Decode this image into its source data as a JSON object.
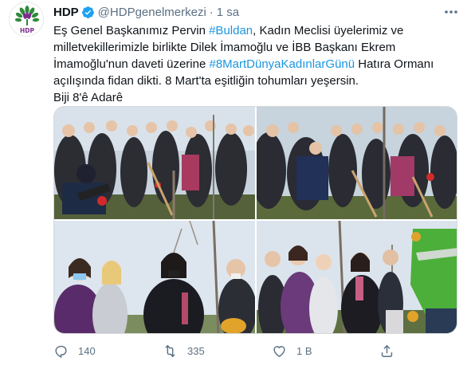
{
  "tweet": {
    "name": "HDP",
    "handle": "@HDPgenelmerkezi",
    "separator": "·",
    "time": "1 sa",
    "more_icon": "more-icon",
    "text": {
      "l1_a": "Eş Genel Başkanımız Pervin ",
      "l1_tag": "#Buldan",
      "l1_b": ", Kadın Meclisi üyelerimiz ve",
      "l2": "milletvekillerimizle birlikte Dilek İmamoğlu ve İBB Başkanı Ekrem",
      "l3_a": "İmamoğlu'nun daveti üzerine ",
      "l3_tag": "#8MartDünyaKadınlarGünü",
      "l3_b": " Hatıra Ormanı",
      "l4": "açılışında fidan dikti. 8 Mart'ta eşitliğin tohumları yeşersin.",
      "l5": "Biji 8'ê Adarê"
    },
    "avatar_label": "HDP",
    "colors": {
      "link": "#1b95e0",
      "verified": "#1da1f2",
      "muted": "#5b7083",
      "logo_green": "#2e8b3a",
      "logo_purple": "#7b2d8b"
    }
  },
  "actions": {
    "reply": {
      "icon": "reply-icon",
      "count": "140"
    },
    "retweet": {
      "icon": "retweet-icon",
      "count": "335"
    },
    "like": {
      "icon": "heart-icon",
      "count": "1 B"
    },
    "share": {
      "icon": "share-icon",
      "count": ""
    }
  }
}
